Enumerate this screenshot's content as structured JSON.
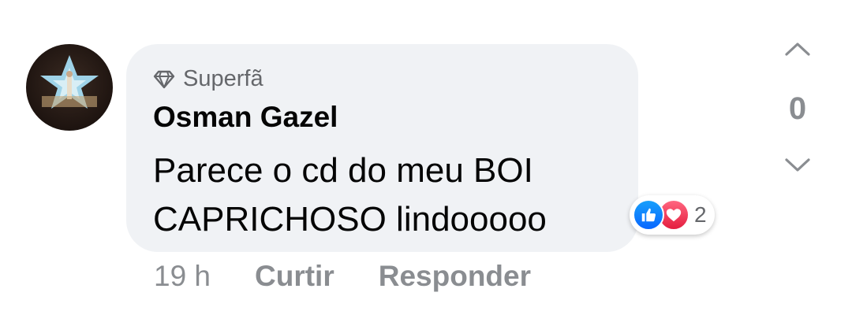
{
  "comment": {
    "badge": "Superfã",
    "author": "Osman Gazel",
    "text_line1": "Parece o cd do meu BOI",
    "text_line2": "CAPRICHOSO lindooooo",
    "reactions": {
      "icons": [
        "thumbs-up-icon",
        "heart-icon"
      ],
      "count": "2"
    },
    "time": "19 h",
    "like_label": "Curtir",
    "reply_label": "Responder"
  },
  "votes": {
    "count": "0"
  },
  "colors": {
    "bubble": "#f0f2f5",
    "like": "#0866ff",
    "love": "#e41e3f",
    "muted": "#8a8d91"
  }
}
